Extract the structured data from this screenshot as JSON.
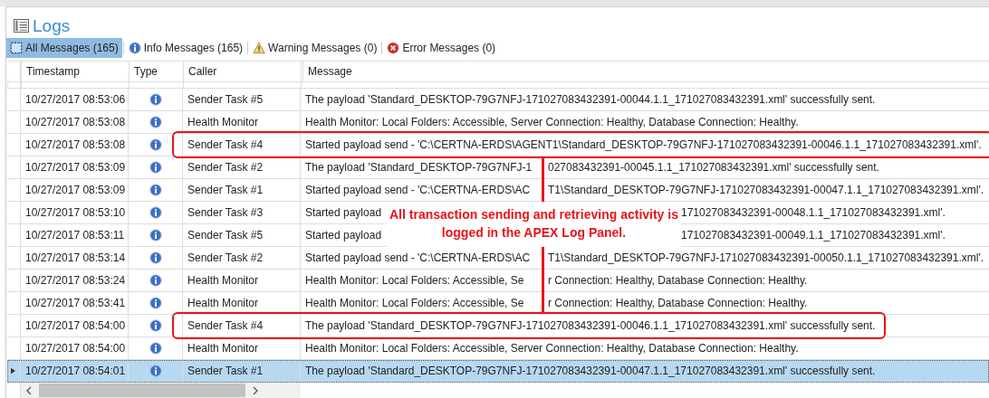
{
  "panel": {
    "title": "Logs"
  },
  "filters": [
    {
      "label": "All Messages (165)",
      "kind": "all",
      "selected": true
    },
    {
      "label": "Info Messages (165)",
      "kind": "info",
      "selected": false
    },
    {
      "label": "Warning Messages (0)",
      "kind": "warning",
      "selected": false
    },
    {
      "label": "Error Messages (0)",
      "kind": "error",
      "selected": false
    }
  ],
  "table": {
    "columns": [
      "Timestamp",
      "Type",
      "Caller",
      "Message"
    ],
    "rows": [
      {
        "timestamp": "10/27/2017 08:53:06",
        "caller": "Sender Task #5",
        "message": "The payload 'Standard_DESKTOP-79G7NFJ-171027083432391-00044.1.1_171027083432391.xml' successfully sent.",
        "selected": false,
        "framed": false
      },
      {
        "timestamp": "10/27/2017 08:53:08",
        "caller": "Health Monitor",
        "message": "Health Monitor: Local Folders: Accessible, Server Connection: Healthy, Database Connection: Healthy.",
        "selected": false,
        "framed": false
      },
      {
        "timestamp": "10/27/2017 08:53:08",
        "caller": "Sender Task #4",
        "message": "Started payload send - 'C:\\CERTNA-ERDS\\AGENT1\\Standard_DESKTOP-79G7NFJ-171027083432391-00046.1.1_171027083432391.xml'.",
        "selected": false,
        "framed": true
      },
      {
        "timestamp": "10/27/2017 08:53:09",
        "caller": "Sender Task #2",
        "message_parts": [
          "The payload 'Standard_DESKTOP-79G7NFJ-1",
          "027083432391-00045.1.1_171027083432391.xml' successfully sent."
        ],
        "kind": "interrupted",
        "selected": false,
        "framed": false
      },
      {
        "timestamp": "10/27/2017 08:53:09",
        "caller": "Sender Task #1",
        "message_parts": [
          "Started payload send - 'C:\\CERTNA-ERDS\\AC",
          "T1\\Standard_DESKTOP-79G7NFJ-171027083432391-00047.1.1_171027083432391.xml'."
        ],
        "kind": "interrupted",
        "selected": false,
        "framed": false
      },
      {
        "timestamp": "10/27/2017 08:53:10",
        "caller": "Sender Task #3",
        "message_parts": [
          "Started payload",
          "171027083432391-00048.1.1_171027083432391.xml'."
        ],
        "kind": "callout",
        "selected": false,
        "framed": false
      },
      {
        "timestamp": "10/27/2017 08:53:11",
        "caller": "Sender Task #5",
        "message_parts": [
          "Started payload",
          "171027083432391-00049.1.1_171027083432391.xml'."
        ],
        "kind": "covered",
        "selected": false,
        "framed": false
      },
      {
        "timestamp": "10/27/2017 08:53:14",
        "caller": "Sender Task #2",
        "message_parts": [
          "Started payload send - 'C:\\CERTNA-ERDS\\AC",
          "T1\\Standard_DESKTOP-79G7NFJ-171027083432391-00050.1.1_171027083432391.xml'."
        ],
        "kind": "interrupted",
        "selected": false,
        "framed": false
      },
      {
        "timestamp": "10/27/2017 08:53:24",
        "caller": "Health Monitor",
        "message_parts": [
          "Health Monitor: Local Folders: Accessible, Se",
          "r Connection: Healthy, Database Connection: Healthy."
        ],
        "kind": "interrupted",
        "selected": false,
        "framed": false
      },
      {
        "timestamp": "10/27/2017 08:53:41",
        "caller": "Health Monitor",
        "message_parts": [
          "Health Monitor: Local Folders: Accessible, Se",
          "r Connection: Healthy, Database Connection: Healthy."
        ],
        "kind": "interrupted",
        "selected": false,
        "framed": false
      },
      {
        "timestamp": "10/27/2017 08:54:00",
        "caller": "Sender Task #4",
        "message": "The payload 'Standard_DESKTOP-79G7NFJ-171027083432391-00046.1.1_171027083432391.xml' successfully sent.",
        "selected": false,
        "framed": true
      },
      {
        "timestamp": "10/27/2017 08:54:00",
        "caller": "Health Monitor",
        "message": "Health Monitor: Local Folders: Accessible, Server Connection: Healthy, Database Connection: Healthy.",
        "selected": false,
        "framed": false
      },
      {
        "timestamp": "10/27/2017 08:54:01",
        "caller": "Sender Task #1",
        "message": "The payload 'Standard_DESKTOP-79G7NFJ-171027083432391-00047.1.1_171027083432391.xml' successfully sent.",
        "selected": true,
        "framed": false
      }
    ]
  },
  "annotation": {
    "text": "All transaction sending and retrieving activity is logged in the APEX Log Panel."
  }
}
